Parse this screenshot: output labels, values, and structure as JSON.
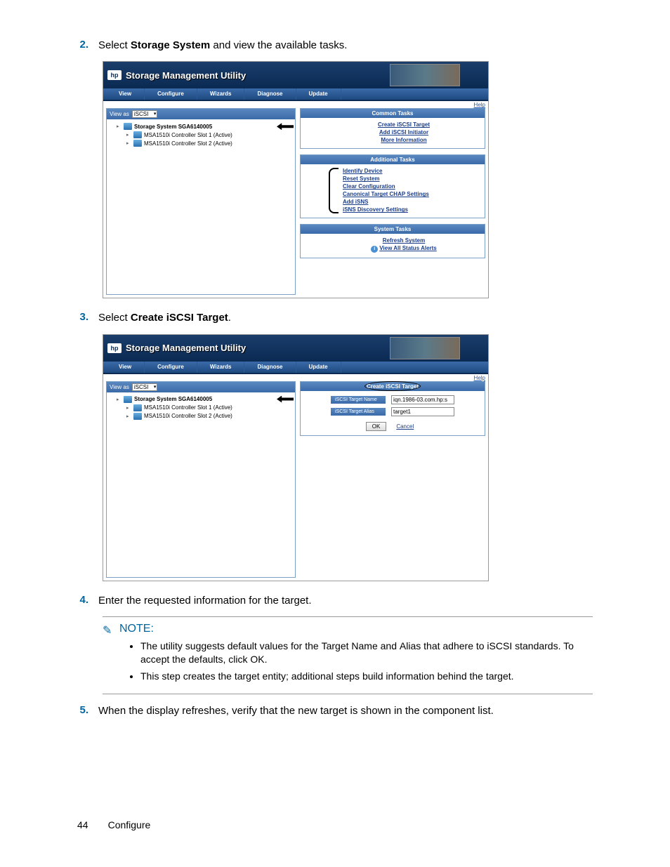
{
  "steps": {
    "s2": {
      "num": "2.",
      "text_pre": "Select ",
      "bold": "Storage System",
      "text_post": " and view the available tasks."
    },
    "s3": {
      "num": "3.",
      "text_pre": "Select ",
      "bold": "Create iSCSI Target",
      "text_post": "."
    },
    "s4": {
      "num": "4.",
      "text": "Enter the requested information for the target."
    },
    "s5": {
      "num": "5.",
      "text": "When the display refreshes, verify that the new target is shown in the component list."
    }
  },
  "shot1": {
    "app_title": "Storage Management Utility",
    "tabs": [
      "View",
      "Configure",
      "Wizards",
      "Diagnose",
      "Update"
    ],
    "help": "Help",
    "view_as_label": "View as",
    "view_as_value": "iSCSI",
    "tree": {
      "root": "Storage System SGA6140005",
      "c1": "MSA1510i Controller Slot 1 (Active)",
      "c2": "MSA1510i Controller Slot 2 (Active)"
    },
    "panels": {
      "common": {
        "title": "Common Tasks",
        "links": [
          "Create iSCSI Target",
          "Add iSCSI Initiator",
          "More Information"
        ]
      },
      "additional": {
        "title": "Additional Tasks",
        "links": [
          "Identify Device",
          "Reset System",
          "Clear Configuration",
          "Canonical Target CHAP Settings",
          "Add iSNS",
          "iSNS Discovery Settings"
        ]
      },
      "system": {
        "title": "System Tasks",
        "links": [
          "Refresh System",
          "View All Status Alerts"
        ]
      }
    }
  },
  "shot2": {
    "app_title": "Storage Management Utility",
    "tabs": [
      "View",
      "Configure",
      "Wizards",
      "Diagnose",
      "Update"
    ],
    "help": "Help",
    "view_as_label": "View as",
    "view_as_value": "iSCSI",
    "tree": {
      "root": "Storage System SGA6140005",
      "c1": "MSA1510i Controller Slot 1 (Active)",
      "c2": "MSA1510i Controller Slot 2 (Active)"
    },
    "form": {
      "title": "Create iSCSI Target",
      "row1_label": "iSCSI Target Name",
      "row1_value": "iqn.1986-03.com.hp:s",
      "row2_label": "iSCSI Target Alias",
      "row2_value": "target1",
      "ok": "OK",
      "cancel": "Cancel"
    }
  },
  "note": {
    "title": "NOTE:",
    "items": [
      {
        "pre": "The utility suggests default values for the ",
        "b1": "Target Name",
        "mid": " and ",
        "b2": "Alias",
        "post": " that adhere to iSCSI standards.  To accept the defaults, click ",
        "b3": "OK",
        "end": "."
      },
      {
        "text": "This step creates the target entity; additional steps build information behind the target."
      }
    ]
  },
  "footer": {
    "page": "44",
    "section": "Configure"
  }
}
